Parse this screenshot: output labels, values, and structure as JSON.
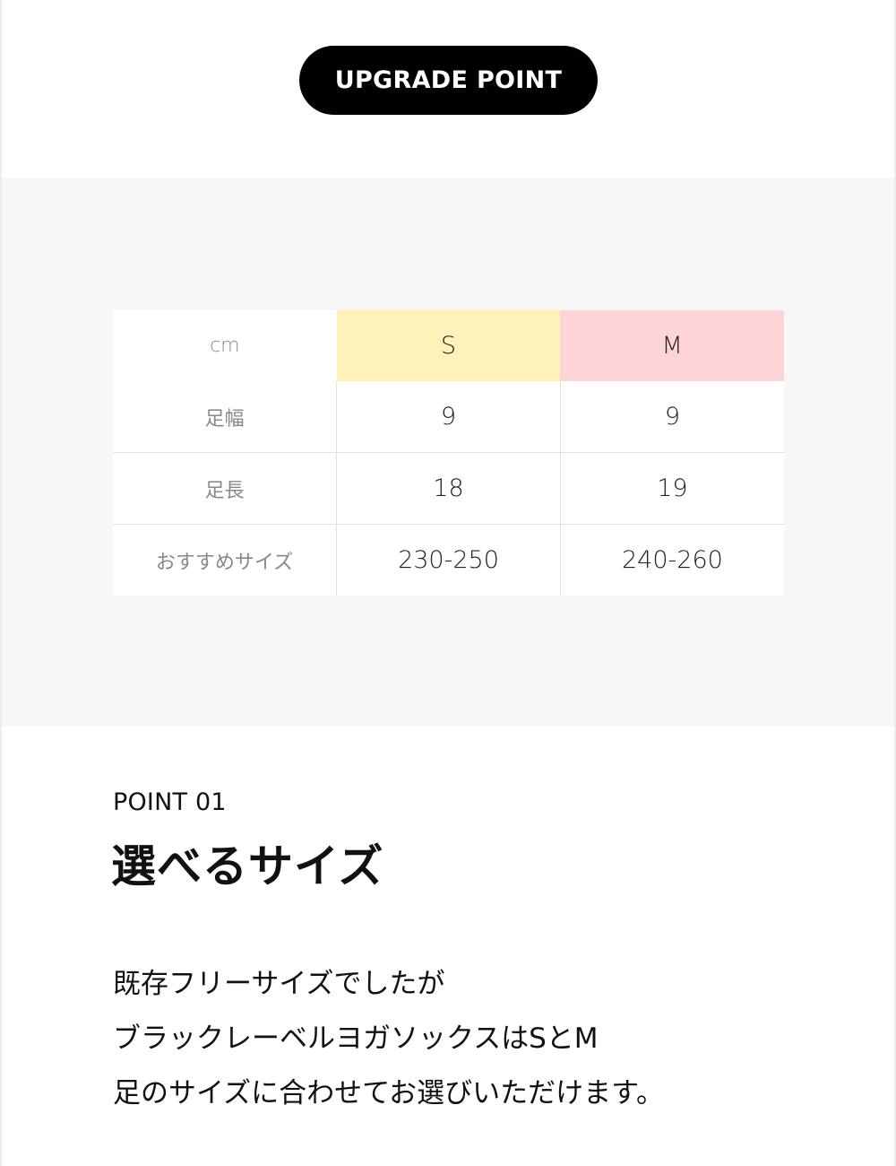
{
  "badge": {
    "label": "UPGRADE POINT"
  },
  "size_table": {
    "header": {
      "unit": "cm",
      "sizes": [
        "S",
        "M"
      ]
    },
    "colors": {
      "S": "#fff2b9",
      "M": "#ffd4d6"
    },
    "rows": [
      {
        "label": "足幅",
        "values": [
          "9",
          "9"
        ]
      },
      {
        "label": "足長",
        "values": [
          "18",
          "19"
        ]
      },
      {
        "label": "おすすめサイズ",
        "values": [
          "230-250",
          "240-260"
        ]
      }
    ]
  },
  "point": {
    "label": "POINT 01",
    "title": "選べるサイズ",
    "description": [
      "既存フリーサイズでしたが",
      "ブラックレーベルヨガソックスはSとM",
      "足のサイズに合わせてお選びいただけます。"
    ]
  }
}
